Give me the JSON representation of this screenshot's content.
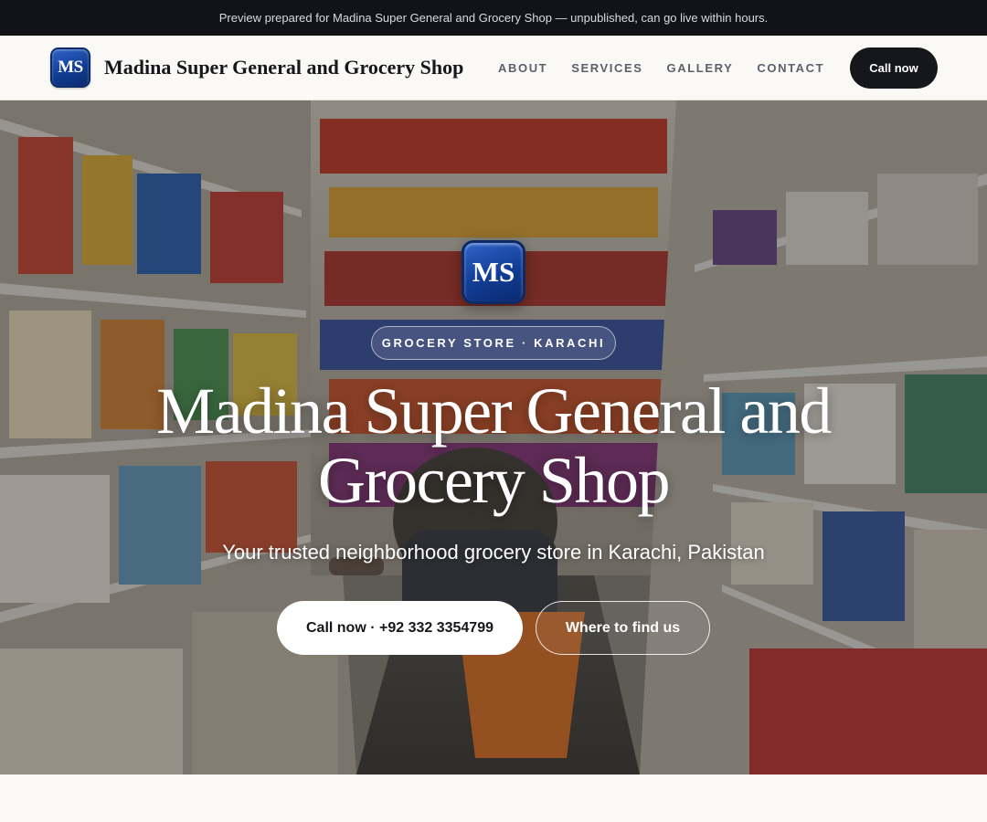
{
  "preview_banner": {
    "text": "Preview prepared for Madina Super General and Grocery Shop — unpublished, can go live within hours."
  },
  "navbar": {
    "logo_text": "MS",
    "brand_name": "Madina Super General and Grocery Shop",
    "links": [
      {
        "label": "ABOUT"
      },
      {
        "label": "SERVICES"
      },
      {
        "label": "GALLERY"
      },
      {
        "label": "CONTACT"
      }
    ],
    "call_label": "Call now"
  },
  "hero": {
    "logo_text": "MS",
    "tagline": "GROCERY STORE · KARACHI",
    "title": "Madina Super General and Grocery Shop",
    "subtitle": "Your trusted neighborhood grocery store in Karachi, Pakistan",
    "primary_button": "Call now · +92 332 3354799",
    "secondary_button": "Where to find us",
    "background_image": "grocery-store-aisle-photo"
  },
  "colors": {
    "dark": "#15171c",
    "preview_bar": "#111318",
    "page_bg": "#faf9f6",
    "logo_blue": "#123d95",
    "nav_link": "#5b606b"
  }
}
